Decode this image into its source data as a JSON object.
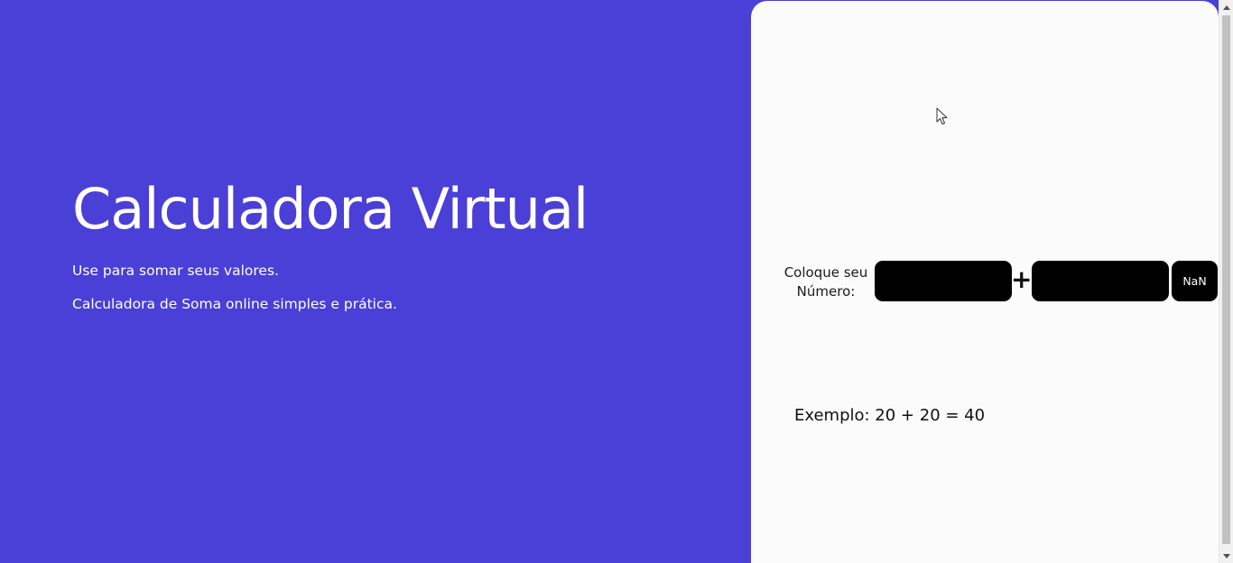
{
  "hero": {
    "title": "Calculadora Virtual",
    "subtitle_1": "Use para somar seus valores.",
    "subtitle_2": "Calculadora de Soma online simples e prática."
  },
  "calculator": {
    "label": "Coloque seu Número:",
    "input_a_value": "",
    "input_b_value": "",
    "operator": "+",
    "result": "NaN",
    "example": "Exemplo: 20 + 20 = 40"
  },
  "colors": {
    "background": "#4a3fd7",
    "panel": "#fbfbfb",
    "input": "#000000"
  },
  "icons": {
    "cursor": "mouse-pointer-icon",
    "scroll_up": "chevron-up-icon",
    "scroll_down": "chevron-down-icon"
  }
}
